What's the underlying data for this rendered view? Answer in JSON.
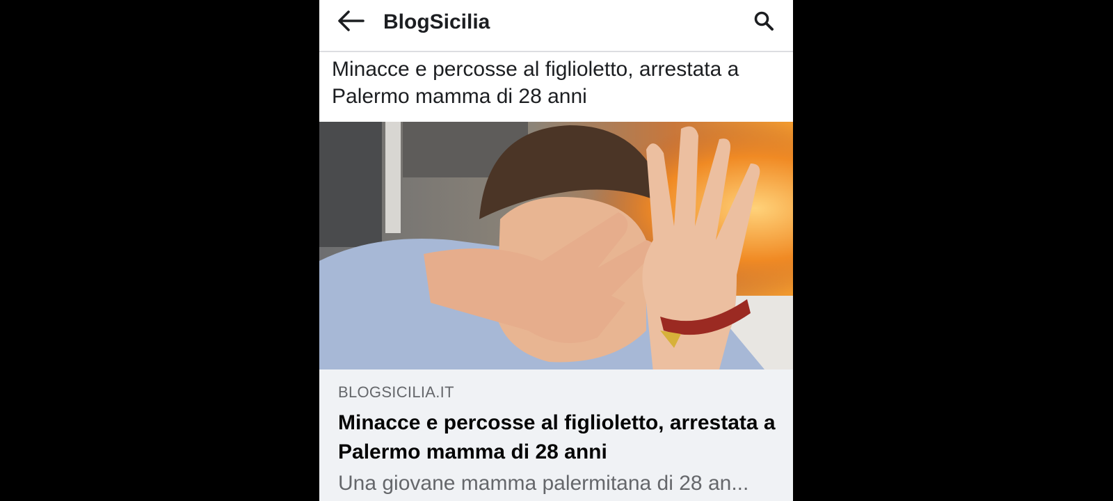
{
  "header": {
    "title": "BlogSicilia",
    "back_icon": "arrow-left-icon",
    "search_icon": "search-icon"
  },
  "post": {
    "text": "Minacce e percosse al figlioletto, arrestata a Palermo mamma di 28 anni"
  },
  "link_card": {
    "domain": "BLOGSICILIA.IT",
    "title": "Minacce e percosse al figlioletto, arrestata a Palermo mamma di 28 anni",
    "description": "Una giovane mamma palermitana di 28 an..."
  },
  "colors": {
    "background": "#000000",
    "surface": "#ffffff",
    "card_body": "#f0f2f5",
    "text_primary": "#1c1e21",
    "text_secondary": "#65676b",
    "divider": "#dcdde1"
  }
}
